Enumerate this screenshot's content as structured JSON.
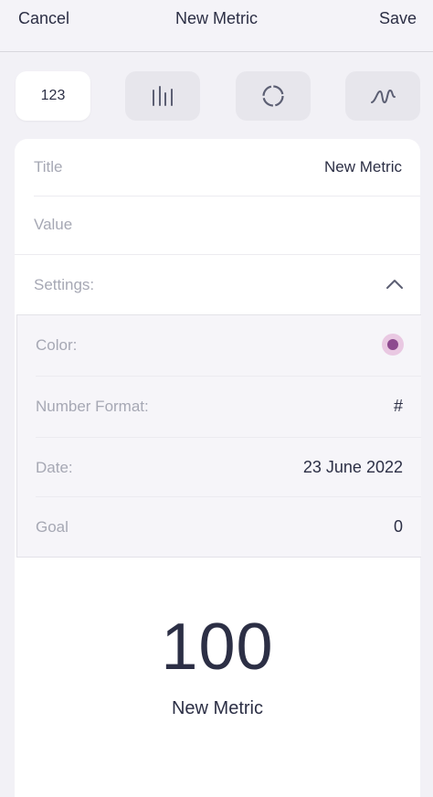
{
  "nav": {
    "cancel": "Cancel",
    "title": "New Metric",
    "save": "Save"
  },
  "metric_types": [
    {
      "label": "123",
      "icon": "number-icon",
      "selected": true
    },
    {
      "label": "",
      "icon": "bar-chart-icon",
      "selected": false
    },
    {
      "label": "",
      "icon": "ring-chart-icon",
      "selected": false
    },
    {
      "label": "",
      "icon": "line-chart-icon",
      "selected": false
    }
  ],
  "form": {
    "title_label": "Title",
    "title_value": "New Metric",
    "value_label": "Value",
    "value_value": "",
    "settings_label": "Settings:"
  },
  "settings": {
    "color_label": "Color:",
    "color_value": "#8d4a8f",
    "number_format_label": "Number Format:",
    "number_format_value": "#",
    "date_label": "Date:",
    "date_value": "23 June 2022",
    "goal_label": "Goal",
    "goal_value": "0"
  },
  "preview": {
    "value": "100",
    "name": "New Metric"
  }
}
